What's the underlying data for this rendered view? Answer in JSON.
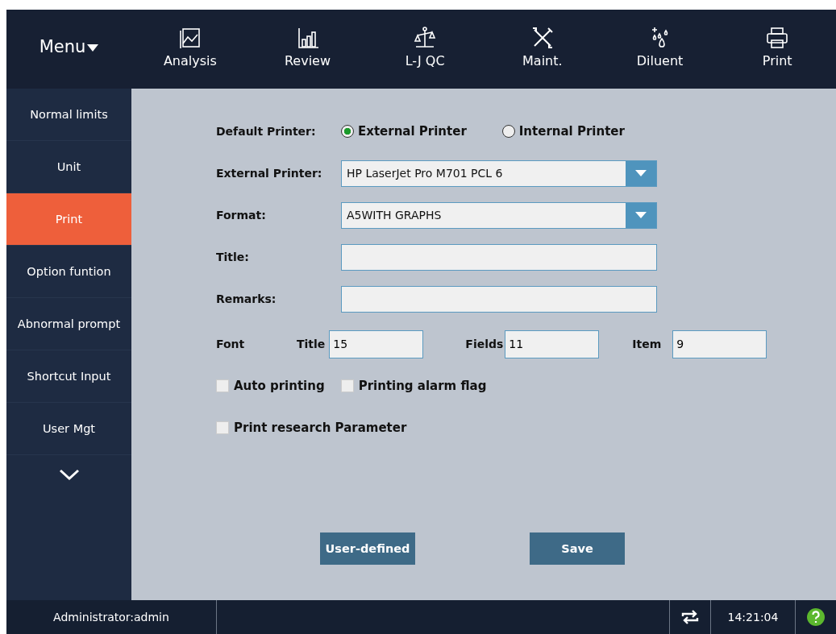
{
  "menu": {
    "label": "Menu"
  },
  "toolbar": [
    {
      "label": "Analysis",
      "kind": "chart"
    },
    {
      "label": "Review",
      "kind": "bars"
    },
    {
      "label": "L-J QC",
      "kind": "scale"
    },
    {
      "label": "Maint.",
      "kind": "tools"
    },
    {
      "label": "Diluent",
      "kind": "drops"
    },
    {
      "label": "Print",
      "kind": "printer"
    }
  ],
  "sidebar": {
    "items": [
      {
        "label": "Normal limits",
        "selected": false
      },
      {
        "label": "Unit",
        "selected": false
      },
      {
        "label": "Print",
        "selected": true
      },
      {
        "label": "Option funtion",
        "selected": false
      },
      {
        "label": "Abnormal prompt",
        "selected": false
      },
      {
        "label": "Shortcut Input",
        "selected": false
      },
      {
        "label": "User Mgt",
        "selected": false
      }
    ]
  },
  "form": {
    "default_printer": {
      "label": "Default Printer:",
      "options": [
        {
          "label": "External Printer",
          "selected": true
        },
        {
          "label": "Internal Printer",
          "selected": false
        }
      ]
    },
    "external_printer": {
      "label": "External Printer:",
      "value": "HP LaserJet Pro M701 PCL 6"
    },
    "format": {
      "label": "Format:",
      "value": "A5WITH GRAPHS"
    },
    "title": {
      "label": "Title:"
    },
    "remarks": {
      "label": "Remarks:"
    },
    "font": {
      "label": "Font",
      "fields": [
        {
          "label": "Title",
          "value": "15"
        },
        {
          "label": "Fields",
          "value": "11"
        },
        {
          "label": "Item",
          "value": "9"
        }
      ]
    },
    "checkbox_rows": [
      [
        {
          "label": "Auto printing",
          "checked": false
        },
        {
          "label": "Printing alarm flag",
          "checked": false
        }
      ],
      [
        {
          "label": "Print research Parameter",
          "checked": false
        }
      ]
    ],
    "buttons": [
      {
        "label": "User-defined"
      },
      {
        "label": "Save"
      }
    ]
  },
  "status_bar": {
    "user": "Administrator:admin",
    "time": "14:21:04"
  }
}
